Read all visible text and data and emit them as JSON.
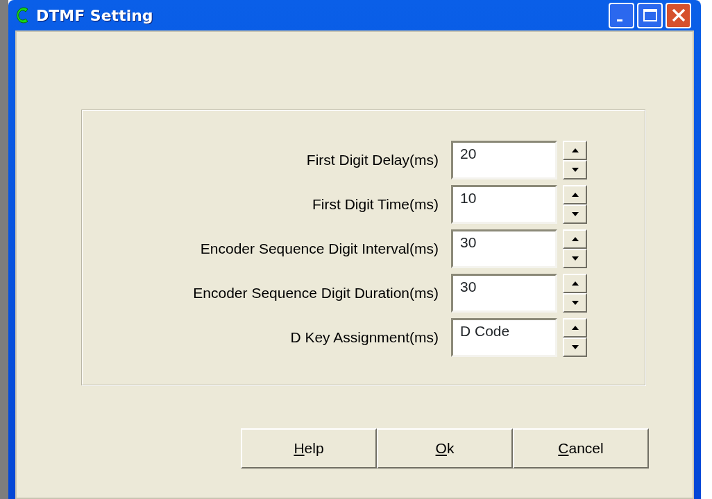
{
  "window": {
    "title": "DTMF Setting"
  },
  "fields": [
    {
      "label": "First Digit Delay(ms)",
      "value": "20"
    },
    {
      "label": "First Digit Time(ms)",
      "value": "10"
    },
    {
      "label": "Encoder Sequence Digit Interval(ms)",
      "value": "30"
    },
    {
      "label": "Encoder Sequence Digit Duration(ms)",
      "value": "30"
    },
    {
      "label": "D Key Assignment(ms)",
      "value": "D Code"
    }
  ],
  "buttons": [
    {
      "label": "Help",
      "first_letter_underlined": true
    },
    {
      "label": "Ok",
      "first_letter_underlined": true
    },
    {
      "label": "Cancel",
      "first_letter_underlined": true
    }
  ]
}
